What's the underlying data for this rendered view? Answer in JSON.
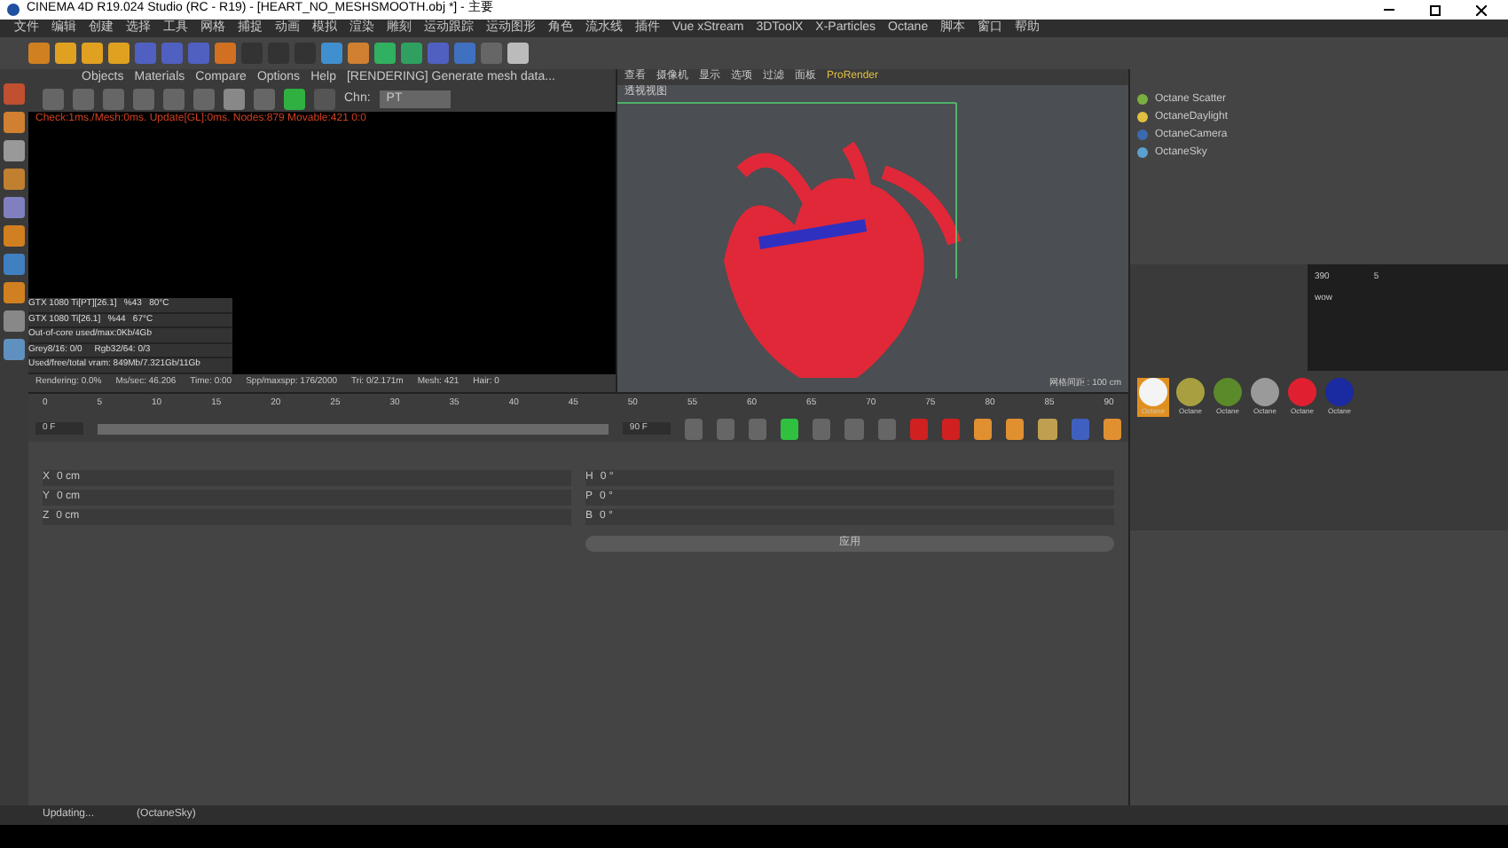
{
  "window": {
    "title": "CINEMA 4D R19.024 Studio (RC - R19) - [HEART_NO_MESHSMOOTH.obj *] - 主要"
  },
  "menu": [
    "文件",
    "编辑",
    "创建",
    "选择",
    "工具",
    "网格",
    "捕捉",
    "动画",
    "模拟",
    "渲染",
    "雕刻",
    "运动跟踪",
    "运动图形",
    "角色",
    "流水线",
    "插件",
    "Vue xStream",
    "3DToolX",
    "X-Particles",
    "Octane",
    "脚本",
    "窗口",
    "帮助"
  ],
  "live_viewer": {
    "menu": [
      "Objects",
      "Materials",
      "Compare",
      "Options",
      "Help"
    ],
    "message": "[RENDERING] Generate mesh data...",
    "channel_label": "Chn:",
    "channel_value": "PT",
    "check_line": "Check:1ms./Mesh:0ms. Update[GL]:0ms. Nodes:879 Movable:421 0:0",
    "gpu_stats": [
      "GTX 1080 Ti[PT][26.1]   %43   80°C",
      "GTX 1080 Ti[26.1]   %44   67°C",
      "Out-of-core used/max:0Kb/4Gb",
      "Grey8/16: 0/0     Rgb32/64: 0/3",
      "Used/free/total vram: 849Mb/7.321Gb/11Gb"
    ],
    "render_status": [
      "Rendering: 0.0%",
      "Ms/sec: 46.206",
      "Time: 0:00",
      "Spp/maxspp: 176/2000",
      "Tri: 0/2.171m",
      "Mesh: 421",
      "Hair: 0"
    ]
  },
  "viewport": {
    "menu": [
      "查看",
      "摄像机",
      "显示",
      "选项",
      "过滤",
      "面板",
      "ProRender"
    ],
    "view_name": "透视视图",
    "grid_spacing": "网格间距 : 100 cm"
  },
  "objects": [
    {
      "name": "Octane Scatter",
      "kind": "scatter"
    },
    {
      "name": "OctaneDaylight",
      "kind": "light"
    },
    {
      "name": "OctaneCamera",
      "kind": "camera"
    },
    {
      "name": "OctaneSky",
      "kind": "sky"
    }
  ],
  "chat": {
    "stats": [
      "390",
      "5"
    ],
    "lines": [
      "wow"
    ]
  },
  "materials": [
    {
      "name": "Octane",
      "color": "#f4f4f4",
      "selected": true
    },
    {
      "name": "Octane",
      "color": "#a8a040",
      "selected": false
    },
    {
      "name": "Octane",
      "color": "#5a8a2a",
      "selected": false
    },
    {
      "name": "Octane",
      "color": "#9a9a9a",
      "selected": false
    },
    {
      "name": "Octane",
      "color": "#e02030",
      "selected": false
    },
    {
      "name": "Octane",
      "color": "#1a2aa0",
      "selected": false
    }
  ],
  "timeline": {
    "ticks": [
      "0",
      "5",
      "10",
      "15",
      "20",
      "25",
      "30",
      "35",
      "40",
      "45",
      "50",
      "55",
      "60",
      "65",
      "70",
      "75",
      "80",
      "85",
      "90"
    ],
    "start": "0 F",
    "end": "90 F",
    "level": 1
  },
  "coordinates": {
    "position": [
      {
        "axis": "X",
        "value": "0 cm"
      },
      {
        "axis": "Y",
        "value": "0 cm"
      },
      {
        "axis": "Z",
        "value": "0 cm"
      }
    ],
    "rotation": [
      {
        "axis": "H",
        "value": "0 °"
      },
      {
        "axis": "P",
        "value": "0 °"
      },
      {
        "axis": "B",
        "value": "0 °"
      }
    ],
    "apply": "应用"
  },
  "status_bar": [
    "Updating...",
    "(OctaneSky)"
  ]
}
